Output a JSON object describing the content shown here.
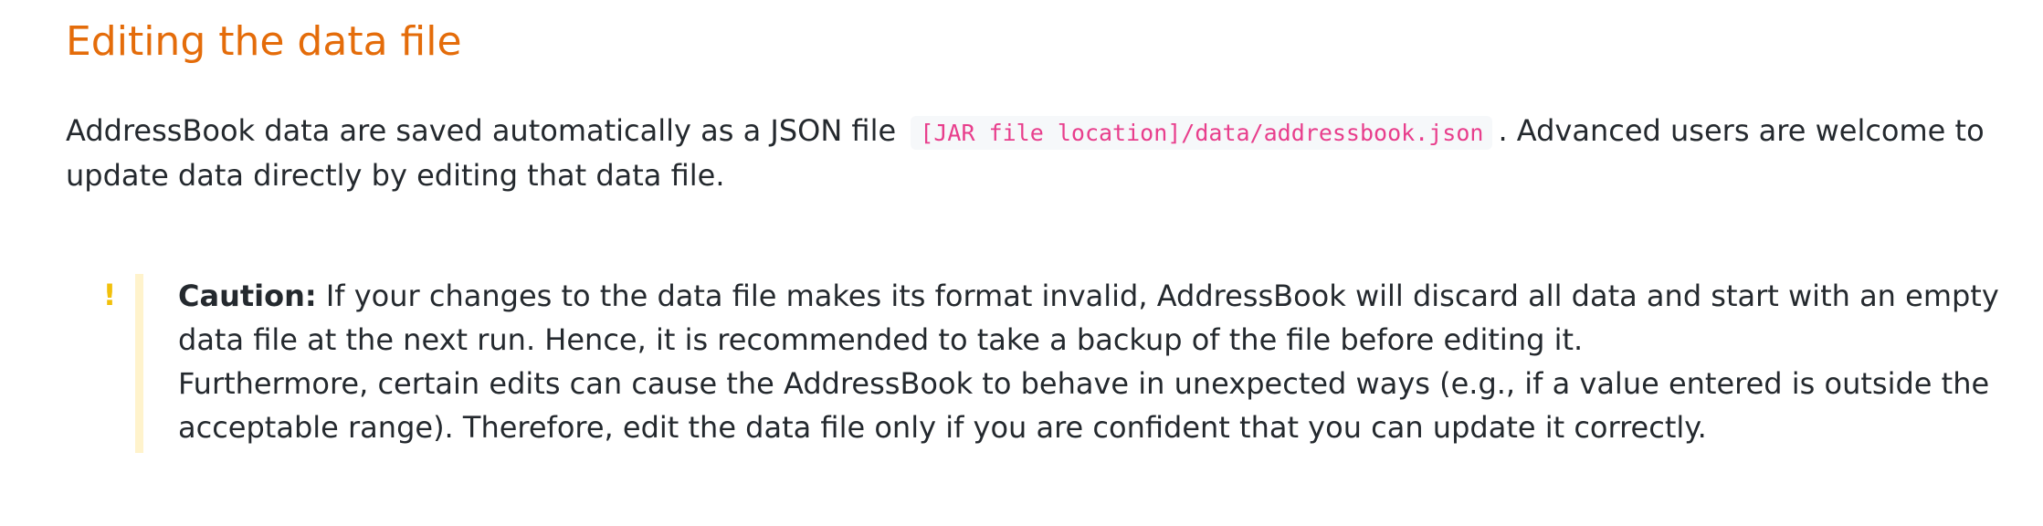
{
  "section": {
    "title": "Editing the data file"
  },
  "intro": {
    "text_before_code": "AddressBook data are saved automatically as a JSON file",
    "code_path": "[JAR file location]/data/addressbook.json",
    "text_after_code": ". Advanced users are welcome to update data directly by editing that data file."
  },
  "caution": {
    "icon": "exclamation-icon",
    "icon_glyph": "!",
    "label": "Caution:",
    "line1": "If your changes to the data file makes its format invalid, AddressBook will discard all data and start with an empty data file at the next run. Hence, it is recommended to take a backup of the file before editing it.",
    "line2": "Furthermore, certain edits can cause the AddressBook to behave in unexpected ways (e.g., if a value entered is outside the acceptable range). Therefore, edit the data file only if you are confident that you can update it correctly."
  },
  "colors": {
    "heading": "#e46c0a",
    "code_text": "#e83e8c",
    "code_background": "#f6f8fa",
    "caution_icon": "#f2c00b",
    "caution_bar": "#fff3cc",
    "body_text": "#24292e"
  }
}
